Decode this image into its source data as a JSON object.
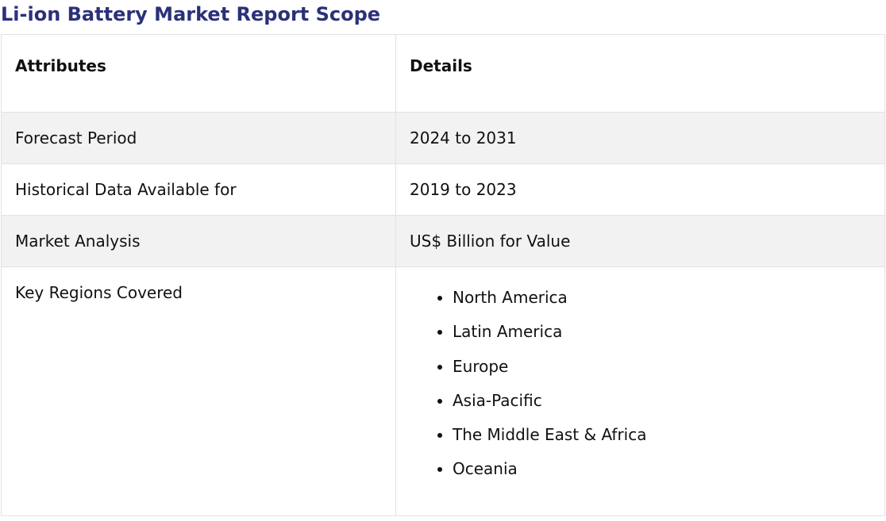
{
  "title": "Li-ion Battery Market Report Scope",
  "table": {
    "headers": [
      "Attributes",
      "Details"
    ],
    "rows": [
      {
        "attribute": "Forecast Period",
        "detail": "2024 to 2031"
      },
      {
        "attribute": "Historical Data Available for",
        "detail": "2019 to 2023"
      },
      {
        "attribute": "Market Analysis",
        "detail": "US$ Billion for Value"
      }
    ],
    "regions": {
      "attribute": "Key Regions Covered",
      "items": [
        "North America",
        "Latin America",
        "Europe",
        "Asia-Pacific",
        "The Middle East & Africa",
        "Oceania"
      ]
    }
  },
  "colors": {
    "title": "#2b3178",
    "row_shade": "#f2f2f2",
    "border": "#e2e2e2"
  }
}
